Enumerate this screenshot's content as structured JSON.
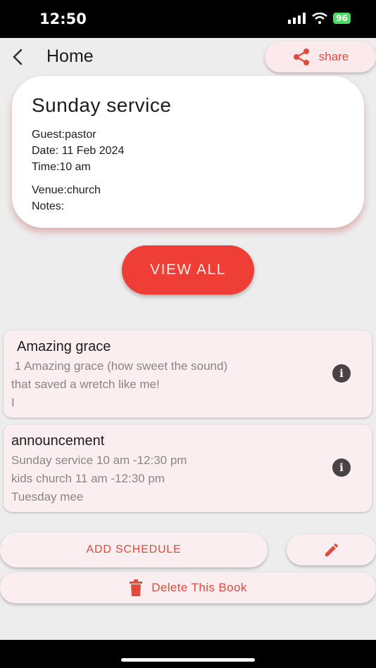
{
  "status_bar": {
    "time": "12:50",
    "battery": "96"
  },
  "app_bar": {
    "title": "Home",
    "share_label": "share"
  },
  "event": {
    "title": "Sunday service",
    "guest": "Guest:pastor",
    "date": "Date: 11 Feb 2024",
    "time": "Time:10 am",
    "venue": "Venue:church",
    "notes": "Notes:"
  },
  "view_all_label": "VIEW ALL",
  "songs": [
    {
      "title": "Amazing grace",
      "text": " 1 Amazing grace (how sweet the sound)\nthat saved a wretch like me!\nI"
    },
    {
      "title": "announcement",
      "text": "Sunday service 10 am -12:30 pm\nkids church 11 am -12:30 pm\nTuesday mee"
    }
  ],
  "actions": {
    "add_schedule_label": "ADD SCHEDULE",
    "delete_label": "Delete This Book"
  },
  "icons": {
    "back": "back-arrow-icon",
    "share": "share-icon",
    "info": "info-icon",
    "edit": "pencil-icon",
    "delete": "trash-icon"
  },
  "colors": {
    "accent": "#ef3e35",
    "accent_text": "#e24a3b",
    "card_tint": "#fbeef0",
    "background": "#ededed"
  }
}
